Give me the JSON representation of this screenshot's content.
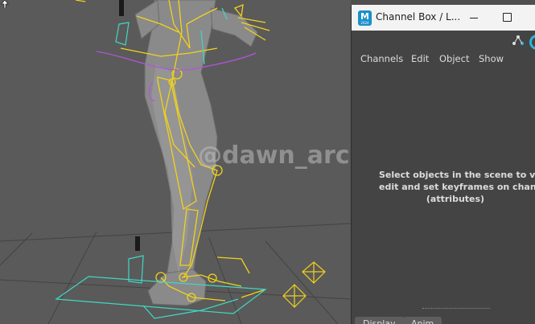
{
  "viewport": {
    "watermark": "@dawn_arc"
  },
  "channel_box": {
    "title": "Channel Box / L...",
    "app_icon": {
      "letter": "M",
      "sub": "2024",
      "color": "#1b90c9"
    },
    "menu": {
      "channels": "Channels",
      "edit": "Edit",
      "object": "Object",
      "show": "Show"
    },
    "empty_message": [
      "Select objects in the scene to view,",
      "edit and set keyframes on channels",
      "(attributes)"
    ],
    "tabs": {
      "display": "Display",
      "anim": "Anim"
    }
  },
  "colors": {
    "viewport_bg": "#5a5a5a",
    "panel_bg": "#444444",
    "rig_yellow": "#f2d21a",
    "rig_cyan": "#3fd9c4",
    "rig_magenta": "#b255d8",
    "accent": "#2fb4d9"
  }
}
